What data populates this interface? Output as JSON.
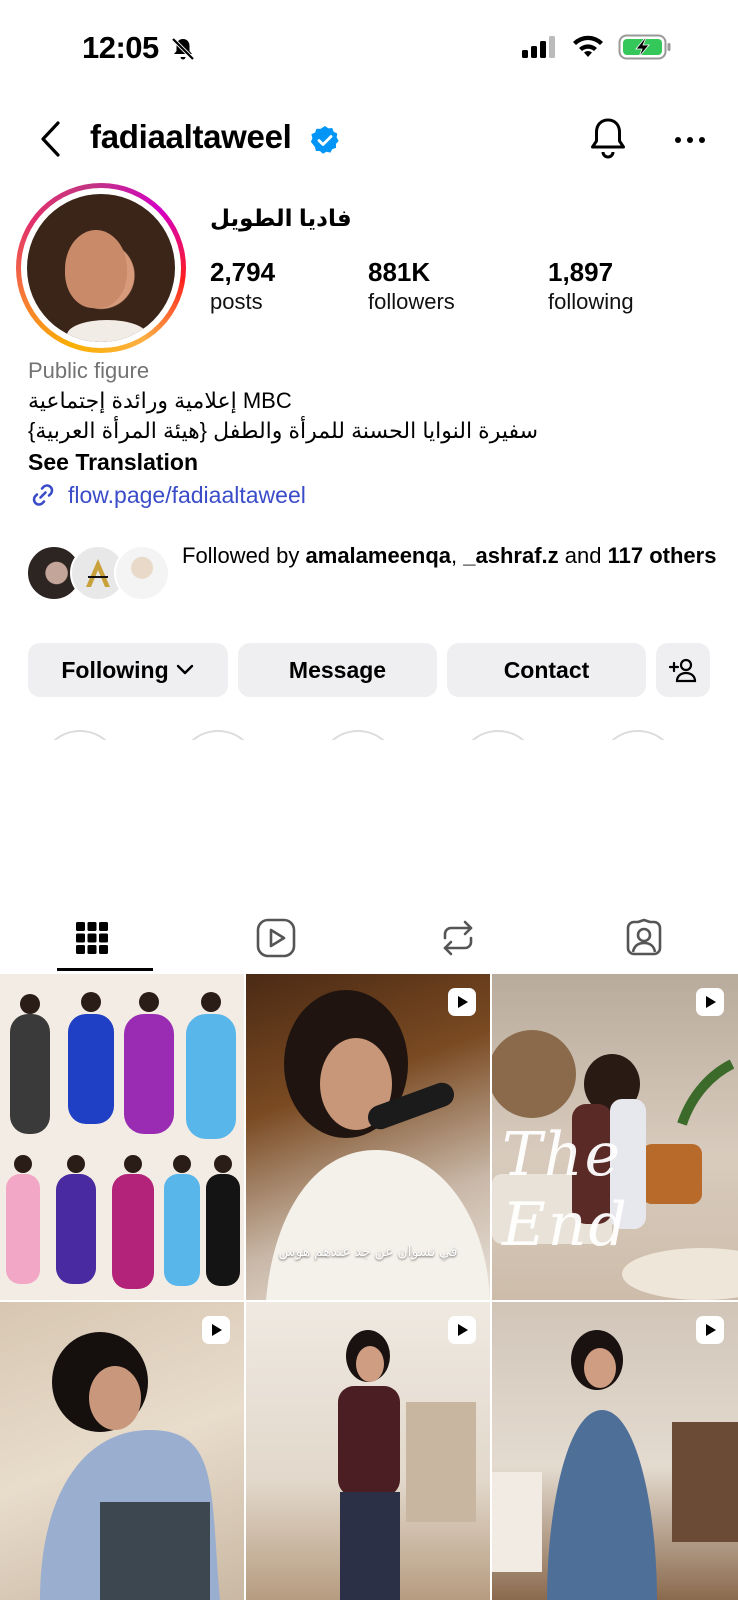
{
  "status_bar": {
    "time": "12:05"
  },
  "header": {
    "username": "fadiaaltaweel"
  },
  "profile": {
    "display_name": "فاديا الطويل",
    "stats": [
      {
        "value": "2,794",
        "label": "posts"
      },
      {
        "value": "881K",
        "label": "followers"
      },
      {
        "value": "1,897",
        "label": "following"
      }
    ],
    "category": "Public figure",
    "bio_line_1": "إعلامية ورائدة إجتماعية MBC",
    "bio_line_2": "سفيرة النوايا الحسنة للمرأة والطفل {هيئة المرأة العربية}",
    "see_translation": "See Translation",
    "link": "flow.page/fadiaaltaweel"
  },
  "followed_by": {
    "prefix": "Followed by ",
    "user1": "amalameenqa",
    "sep": ", ",
    "user2": "_ashraf.z",
    "and": " and ",
    "others": "117 others"
  },
  "actions": {
    "following": "Following",
    "message": "Message",
    "contact": "Contact"
  },
  "grid": {
    "caption_2": "في نسوان عن جد عندهم هوس",
    "overlay_3": "The End"
  },
  "colors": {
    "verified": "#0095f6",
    "link": "#3b4cc9",
    "battery": "#34c759",
    "button_bg": "#efeff1"
  }
}
